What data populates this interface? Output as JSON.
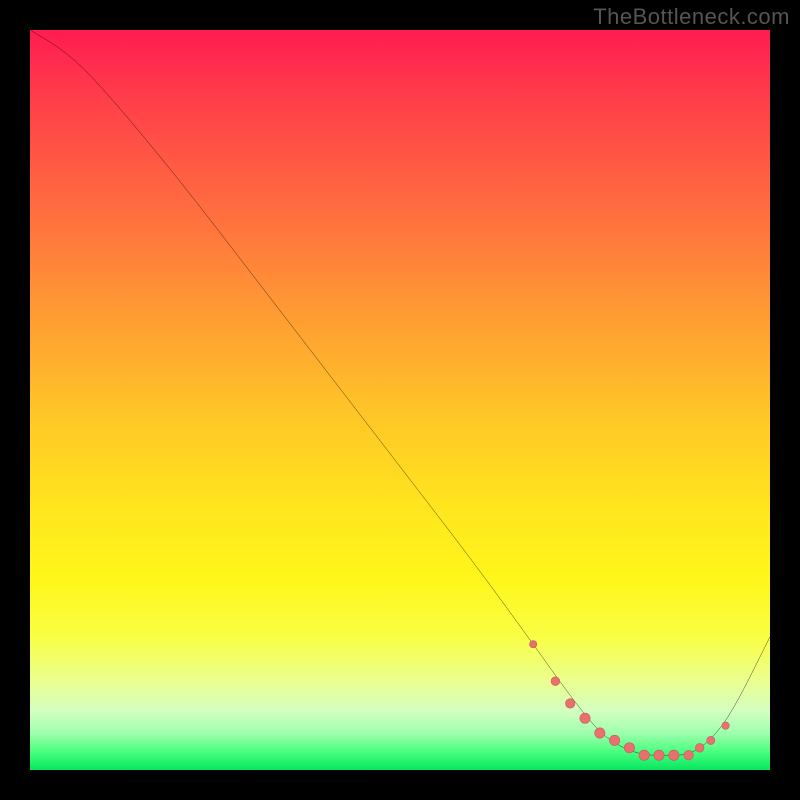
{
  "watermark": "TheBottleneck.com",
  "colors": {
    "frame_bg": "#000000",
    "line": "#000000",
    "marker_fill": "#e8716f",
    "marker_stroke": "#cc5a58"
  },
  "chart_data": {
    "type": "line",
    "title": "",
    "xlabel": "",
    "ylabel": "",
    "xlim": [
      0,
      100
    ],
    "ylim": [
      0,
      100
    ],
    "grid": false,
    "legend": false,
    "series": [
      {
        "name": "curve",
        "x": [
          0,
          5,
          10,
          20,
          30,
          40,
          50,
          60,
          68,
          73,
          77,
          80,
          83,
          86,
          89,
          92,
          95,
          100
        ],
        "y": [
          100,
          97,
          92,
          80,
          67,
          54,
          41,
          28,
          17,
          10,
          5,
          3,
          2,
          2,
          2,
          4,
          8,
          18
        ]
      }
    ],
    "markers": {
      "name": "flat-region",
      "x": [
        68,
        71,
        73,
        75,
        77,
        79,
        81,
        83,
        85,
        87,
        89,
        90.5,
        92,
        94
      ],
      "y": [
        17,
        12,
        9,
        7,
        5,
        4,
        3,
        2,
        2,
        2,
        2,
        3,
        4,
        6
      ],
      "r": [
        3.5,
        4.2,
        4.6,
        5.0,
        5.0,
        5.0,
        5.0,
        5.0,
        5.0,
        5.0,
        4.6,
        4.2,
        4.0,
        3.6
      ]
    },
    "white_band_region": {
      "y_start": 68,
      "y_end": 92
    }
  }
}
